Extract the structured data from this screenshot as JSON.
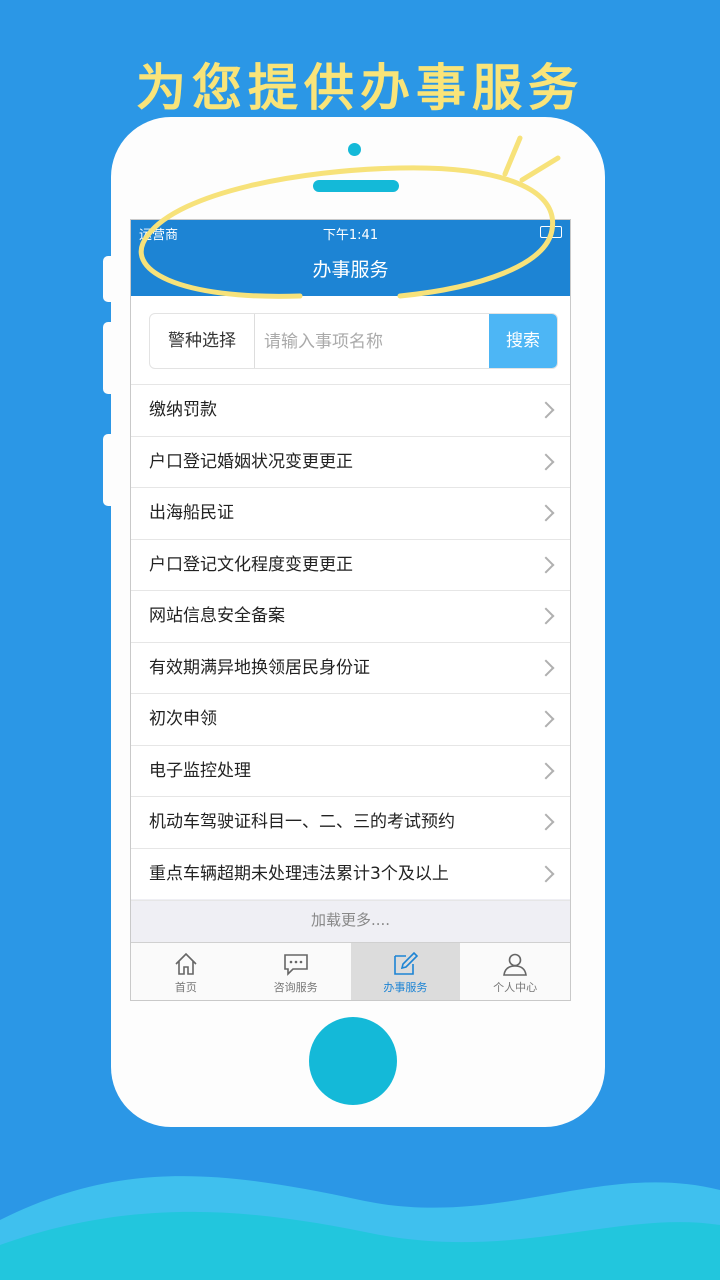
{
  "promo": {
    "title": "为您提供办事服务"
  },
  "status_bar": {
    "carrier": "运营商",
    "time": "下午1:41"
  },
  "nav": {
    "title": "办事服务"
  },
  "search": {
    "select_label": "警种选择",
    "placeholder": "请输入事项名称",
    "button_label": "搜索"
  },
  "items": [
    {
      "label": "缴纳罚款"
    },
    {
      "label": "户口登记婚姻状况变更更正"
    },
    {
      "label": "出海船民证"
    },
    {
      "label": "户口登记文化程度变更更正"
    },
    {
      "label": "网站信息安全备案"
    },
    {
      "label": "有效期满异地换领居民身份证"
    },
    {
      "label": "初次申领"
    },
    {
      "label": "电子监控处理"
    },
    {
      "label": "机动车驾驶证科目一、二、三的考试预约"
    },
    {
      "label": "重点车辆超期未处理违法累计3个及以上"
    }
  ],
  "load_more": "加载更多....",
  "tabs": [
    {
      "label": "首页",
      "icon": "home-icon"
    },
    {
      "label": "咨询服务",
      "icon": "chat-icon"
    },
    {
      "label": "办事服务",
      "icon": "edit-icon"
    },
    {
      "label": "个人中心",
      "icon": "user-icon"
    }
  ],
  "colors": {
    "background": "#2b97e6",
    "title": "#f9e479",
    "nav": "#1d84d4",
    "accent": "#14b9d8",
    "search_button": "#4db6f5"
  }
}
